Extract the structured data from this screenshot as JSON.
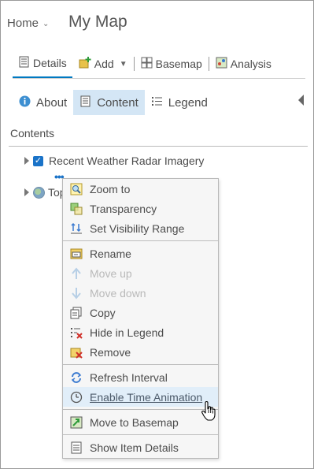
{
  "header": {
    "home_label": "Home",
    "map_title": "My Map"
  },
  "toolbar": {
    "details": "Details",
    "add": "Add",
    "basemap": "Basemap",
    "analysis": "Analysis"
  },
  "tabs": {
    "about": "About",
    "content": "Content",
    "legend": "Legend"
  },
  "contents_label": "Contents",
  "layers": [
    {
      "label": "Recent Weather Radar Imagery",
      "checked": true
    },
    {
      "label": "Top"
    }
  ],
  "menu": {
    "zoom_to": "Zoom to",
    "transparency": "Transparency",
    "set_visibility_range": "Set Visibility Range",
    "rename": "Rename",
    "move_up": "Move up",
    "move_down": "Move down",
    "copy": "Copy",
    "hide_in_legend": "Hide in Legend",
    "remove": "Remove",
    "refresh_interval": "Refresh Interval",
    "enable_time_animation": "Enable Time Animation",
    "move_to_basemap": "Move to Basemap",
    "show_item_details": "Show Item Details"
  },
  "colors": {
    "accent": "#0079c1",
    "active_tab_bg": "#d4e6f5",
    "menu_hover_bg": "#e1eef9"
  }
}
